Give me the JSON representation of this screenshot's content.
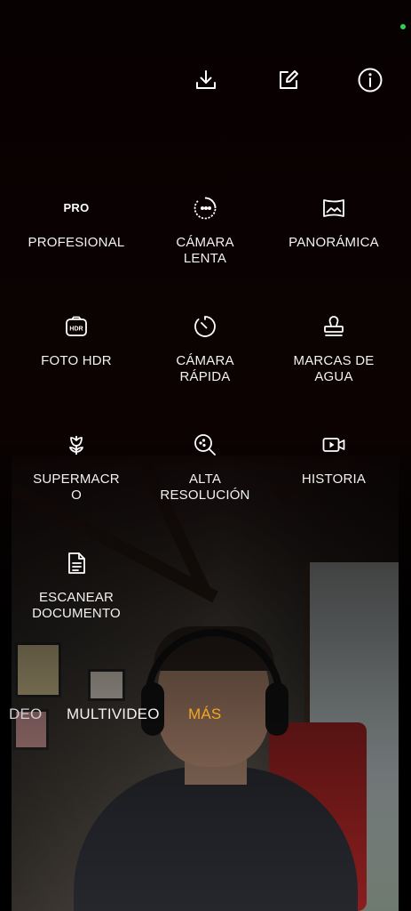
{
  "toolbar": {
    "download_icon": "download-icon",
    "edit_icon": "edit-icon",
    "info_icon": "info-icon"
  },
  "modes": [
    {
      "label": "PROFESIONAL",
      "icon": "pro-icon",
      "icon_text": "PRO"
    },
    {
      "label": "CÁMARA\nLENTA",
      "icon": "slow-motion-icon"
    },
    {
      "label": "PANORÁMICA",
      "icon": "panorama-icon"
    },
    {
      "label": "FOTO HDR",
      "icon": "hdr-icon",
      "icon_text": "HDR"
    },
    {
      "label": "CÁMARA\nRÁPIDA",
      "icon": "timelapse-icon"
    },
    {
      "label": "MARCAS DE\nAGUA",
      "icon": "watermark-stamp-icon"
    },
    {
      "label": "SUPERMACR\nO",
      "icon": "macro-flower-icon"
    },
    {
      "label": "ALTA\nRESOLUCIÓN",
      "icon": "high-resolution-icon"
    },
    {
      "label": "HISTORIA",
      "icon": "story-video-icon"
    },
    {
      "label": "ESCANEAR\nDOCUMENTO",
      "icon": "document-scan-icon"
    }
  ],
  "mode_tabs": {
    "partial": "DEO",
    "multivideo": "MULTIVIDEO",
    "mas": "MÁS"
  },
  "colors": {
    "accent": "#f5a623",
    "status_dot": "#2fd05a",
    "background": "#0c0202"
  }
}
